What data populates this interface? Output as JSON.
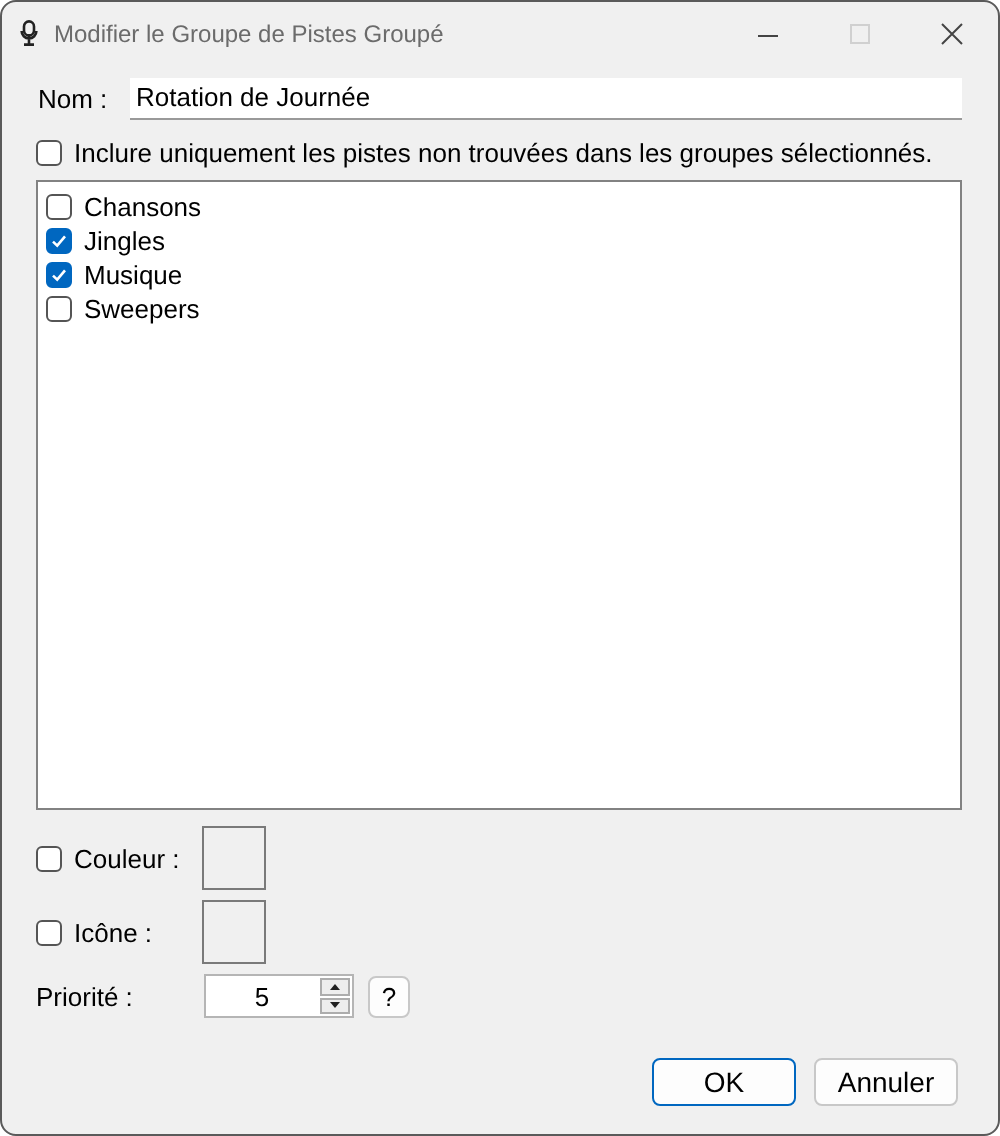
{
  "window": {
    "title": "Modifier le Groupe de Pistes Groupé"
  },
  "name_field": {
    "label": "Nom :",
    "value": "Rotation de Journée"
  },
  "exclusive_option": {
    "label": "Inclure uniquement les pistes non trouvées dans les groupes sélectionnés.",
    "checked": false
  },
  "groups": [
    {
      "label": "Chansons",
      "checked": false
    },
    {
      "label": "Jingles",
      "checked": true
    },
    {
      "label": "Musique",
      "checked": true
    },
    {
      "label": "Sweepers",
      "checked": false
    }
  ],
  "color_option": {
    "label": "Couleur :",
    "checked": false
  },
  "icon_option": {
    "label": "Icône :",
    "checked": false
  },
  "priority": {
    "label": "Priorité :",
    "value": "5",
    "help": "?"
  },
  "buttons": [
    {
      "label": "OK",
      "default": true
    },
    {
      "label": "Annuler",
      "default": false
    }
  ]
}
